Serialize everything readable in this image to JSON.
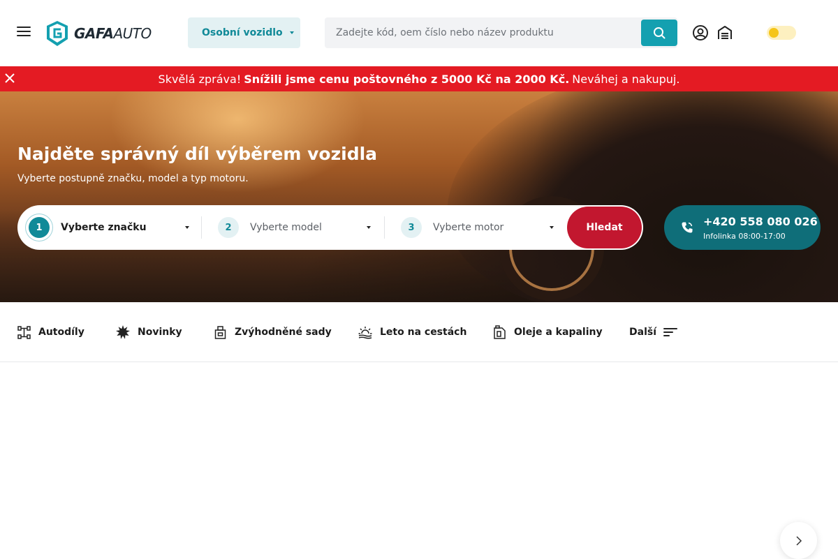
{
  "header": {
    "logo_text_bold": "GAFA",
    "logo_text_light": "AUTO",
    "vehicle_type": "Osobní vozidlo",
    "search_placeholder": "Zadejte kód, oem číslo nebo název produktu"
  },
  "promo": {
    "lead": "Skvělá zpráva!",
    "highlight": "Snížili jsme cenu poštovného z 5000 Kč na 2000 Kč.",
    "tail": "Neváhej a nakupuj."
  },
  "hero": {
    "title": "Najděte správný díl výběrem vozidla",
    "subtitle": "Vyberte postupně značku, model a typ motoru.",
    "steps": [
      {
        "num": "1",
        "label": "Vyberte značku"
      },
      {
        "num": "2",
        "label": "Vyberte model"
      },
      {
        "num": "3",
        "label": "Vyberte motor"
      }
    ],
    "search_button": "Hledat",
    "phone": "+420 558 080 026",
    "phone_hours": "Infolinka 08:00-17:00"
  },
  "categories": [
    {
      "label": "Autodíly",
      "icon": "car-parts-icon"
    },
    {
      "label": "Novinky",
      "icon": "starburst-icon"
    },
    {
      "label": "Zvýhodněné sady",
      "icon": "package-icon"
    },
    {
      "label": "Leto na cestách",
      "icon": "sunset-icon"
    },
    {
      "label": "Oleje a kapaliny",
      "icon": "oil-canister-icon"
    },
    {
      "label": "Další",
      "icon": "menu-lines-icon"
    }
  ],
  "colors": {
    "accent": "#118a98",
    "promo_red": "#e41b23",
    "search_red": "#c2172f",
    "phone_teal": "#0f6e79"
  }
}
